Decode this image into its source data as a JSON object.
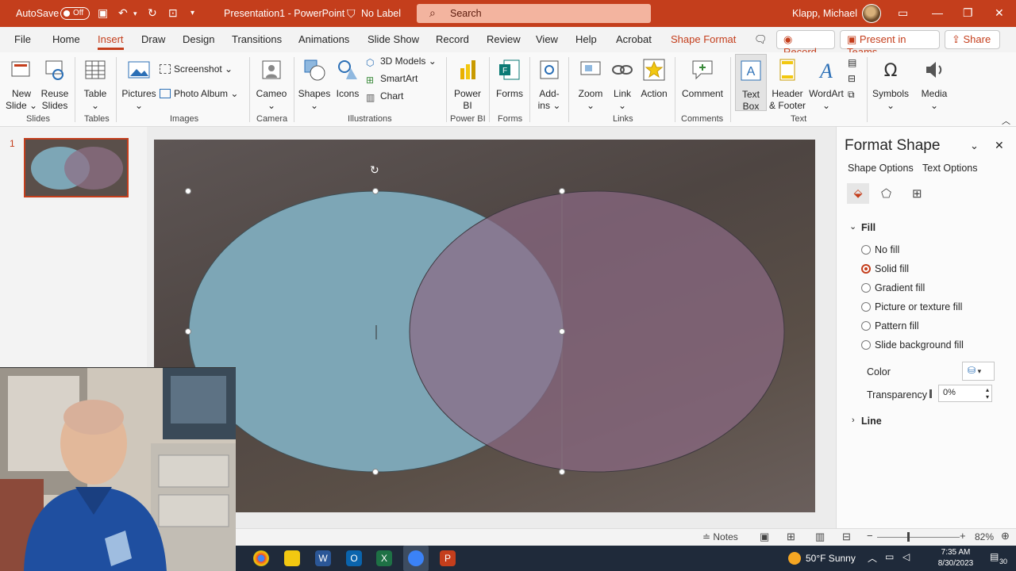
{
  "titlebar": {
    "autosave_label": "AutoSave",
    "autosave_state": "Off",
    "document_title": "Presentation1  -  PowerPoint",
    "sensitivity_label": "No Label",
    "search_placeholder": "Search",
    "user_name": "Klapp, Michael"
  },
  "tabs": [
    "File",
    "Home",
    "Insert",
    "Draw",
    "Design",
    "Transitions",
    "Animations",
    "Slide Show",
    "Record",
    "Review",
    "View",
    "Help",
    "Acrobat",
    "Shape Format"
  ],
  "active_tab": "Insert",
  "tab_actions": {
    "record": "Record",
    "present": "Present in Teams",
    "share": "Share"
  },
  "ribbon": {
    "new_slide": [
      "New",
      "Slide"
    ],
    "reuse_slides": [
      "Reuse",
      "Slides"
    ],
    "table": "Table",
    "pictures": "Pictures",
    "screenshot": "Screenshot",
    "photo_album": "Photo Album",
    "cameo": "Cameo",
    "shapes": "Shapes",
    "icons": "Icons",
    "models3d": "3D Models",
    "smartart": "SmartArt",
    "chart": "Chart",
    "powerbi": [
      "Power",
      "BI"
    ],
    "forms": "Forms",
    "addins": [
      "Add-",
      "ins"
    ],
    "zoom": "Zoom",
    "link": "Link",
    "action": "Action",
    "comment": "Comment",
    "textbox": [
      "Text",
      "Box"
    ],
    "header_footer": [
      "Header",
      "& Footer"
    ],
    "wordart": "WordArt",
    "symbols": "Symbols",
    "media": "Media",
    "groups": {
      "slides": "Slides",
      "tables": "Tables",
      "images": "Images",
      "camera": "Camera",
      "illustrations": "Illustrations",
      "powerbi": "Power BI",
      "forms": "Forms",
      "links": "Links",
      "comments": "Comments",
      "text": "Text"
    }
  },
  "slide_panel": {
    "slide_number": "1"
  },
  "format_pane": {
    "title": "Format Shape",
    "tab_shape_options": "Shape Options",
    "tab_text_options": "Text Options",
    "fill_header": "Fill",
    "fill_options": [
      "No fill",
      "Solid fill",
      "Gradient fill",
      "Picture or texture fill",
      "Pattern fill",
      "Slide background fill"
    ],
    "selected_fill": "Solid fill",
    "color_label": "Color",
    "transparency_label": "Transparency",
    "transparency_value": "0%",
    "line_header": "Line"
  },
  "statusbar": {
    "notes": "Notes",
    "zoom": "82%"
  },
  "taskbar": {
    "weather": "50°F  Sunny",
    "time": "7:35 AM",
    "date": "8/30/2023",
    "notifications": "30"
  },
  "colors": {
    "accent": "#c43e1c",
    "left_ellipse": "#7da6b6",
    "right_ellipse": "#6b4a5e"
  }
}
